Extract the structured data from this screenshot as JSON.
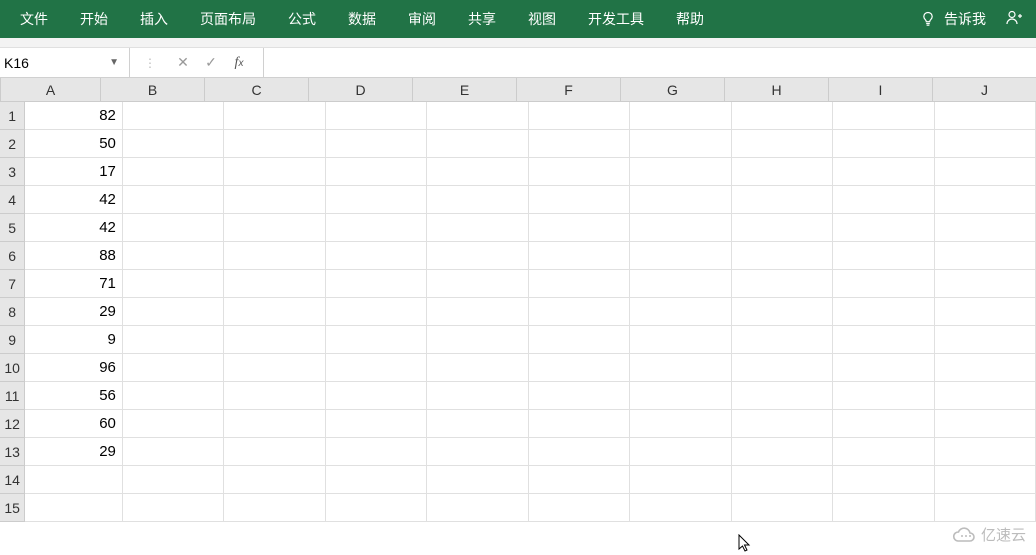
{
  "ribbon": {
    "tabs": [
      "文件",
      "开始",
      "插入",
      "页面布局",
      "公式",
      "数据",
      "审阅",
      "共享",
      "视图",
      "开发工具",
      "帮助"
    ],
    "tellme": "告诉我"
  },
  "namebox": {
    "value": "K16"
  },
  "formula": {
    "value": ""
  },
  "columns": [
    "A",
    "B",
    "C",
    "D",
    "E",
    "F",
    "G",
    "H",
    "I",
    "J"
  ],
  "rows": [
    "1",
    "2",
    "3",
    "4",
    "5",
    "6",
    "7",
    "8",
    "9",
    "10",
    "11",
    "12",
    "13",
    "14",
    "15"
  ],
  "cellsA": [
    "82",
    "50",
    "17",
    "42",
    "42",
    "88",
    "71",
    "29",
    "9",
    "96",
    "56",
    "60",
    "29",
    "",
    ""
  ],
  "watermark": "亿速云"
}
